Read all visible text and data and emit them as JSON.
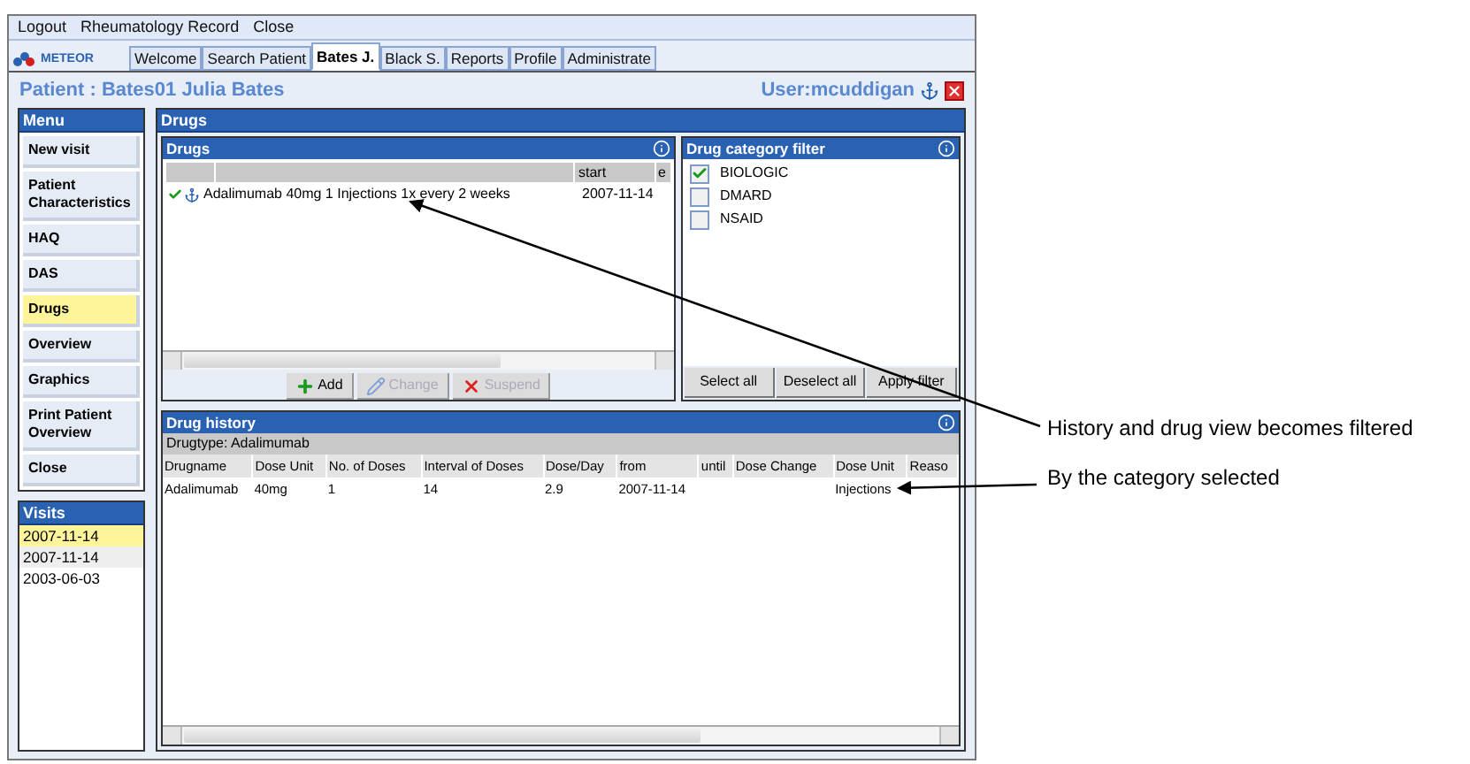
{
  "menu_bar": [
    "Logout",
    "Rheumatology Record",
    "Close"
  ],
  "logo": {
    "text": "METEOR"
  },
  "tabs": [
    {
      "label": "Welcome",
      "selected": false
    },
    {
      "label": "Search Patient",
      "selected": false
    },
    {
      "label": "Bates J.",
      "selected": true
    },
    {
      "label": "Black S.",
      "selected": false
    },
    {
      "label": "Reports",
      "selected": false
    },
    {
      "label": "Profile",
      "selected": false
    },
    {
      "label": "Administrate",
      "selected": false
    }
  ],
  "patient_title": "Patient : Bates01 Julia Bates",
  "user_label": "User:mcuddigan",
  "menu": {
    "title": "Menu",
    "items": [
      {
        "label": "New visit",
        "selected": false
      },
      {
        "label": "Patient Characteristics",
        "selected": false
      },
      {
        "label": "HAQ",
        "selected": false
      },
      {
        "label": "DAS",
        "selected": false
      },
      {
        "label": "Drugs",
        "selected": true
      },
      {
        "label": "Overview",
        "selected": false
      },
      {
        "label": "Graphics",
        "selected": false
      },
      {
        "label": "Print Patient Overview",
        "selected": false
      },
      {
        "label": "Close",
        "selected": false
      }
    ]
  },
  "visits": {
    "title": "Visits",
    "items": [
      {
        "label": "2007-11-14",
        "selected": true
      },
      {
        "label": "2007-11-14",
        "selected": false
      },
      {
        "label": "2003-06-03",
        "selected": false
      }
    ]
  },
  "drugs_panel": {
    "title": "Drugs",
    "list": {
      "title": "Drugs",
      "columns": [
        "start",
        "e"
      ],
      "rows": [
        {
          "active": true,
          "text": "Adalimumab 40mg 1 Injections 1x every 2 weeks",
          "start": "2007-11-14"
        }
      ]
    },
    "buttons": [
      {
        "kind": "add",
        "label": "Add",
        "disabled": false
      },
      {
        "kind": "change",
        "label": "Change",
        "disabled": true
      },
      {
        "kind": "suspend",
        "label": "Suspend",
        "disabled": true
      }
    ],
    "filter": {
      "title": "Drug category filter",
      "options": [
        {
          "label": "BIOLOGIC",
          "checked": true
        },
        {
          "label": "DMARD",
          "checked": false
        },
        {
          "label": "NSAID",
          "checked": false
        }
      ],
      "buttons": [
        "Select all",
        "Deselect all",
        "Apply filter"
      ]
    },
    "history": {
      "title": "Drug history",
      "group": "Drugtype: Adalimumab",
      "columns": [
        "Drugname",
        "Dose Unit",
        "No. of Doses",
        "Interval of Doses",
        "Dose/Day",
        "from",
        "until",
        "Dose Change",
        "Dose Unit",
        "Reaso"
      ],
      "rows": [
        {
          "cells": [
            "Adalimumab",
            "40mg",
            "1",
            "14",
            "2.9",
            "2007-11-14",
            null,
            null,
            "Injections",
            null
          ]
        }
      ]
    }
  },
  "annotations": [
    {
      "text": "History and drug view becomes filtered"
    },
    {
      "text": "By the category selected"
    }
  ]
}
